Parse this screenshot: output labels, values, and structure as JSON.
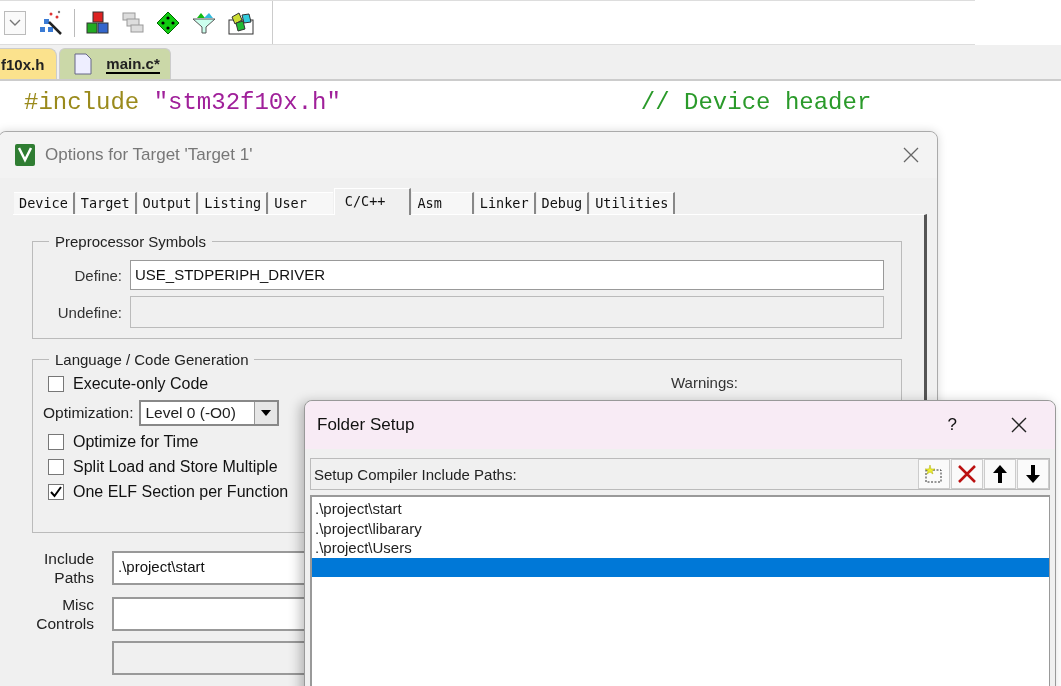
{
  "editor": {
    "tabs": [
      {
        "label": "f10x.h",
        "selected": false
      },
      {
        "label": "main.c*",
        "selected": true
      }
    ],
    "code_line": {
      "directive": "#include",
      "header": "\"stm32f10x.h\"",
      "comment": "// Device header"
    }
  },
  "options_dialog": {
    "title": "Options for Target 'Target 1'",
    "tabs": [
      {
        "label": "Device",
        "selected": false
      },
      {
        "label": "Target",
        "selected": false
      },
      {
        "label": "Output",
        "selected": false
      },
      {
        "label": "Listing",
        "selected": false
      },
      {
        "label": "User",
        "selected": false
      },
      {
        "label": "C/C++",
        "selected": true
      },
      {
        "label": "Asm",
        "selected": false
      },
      {
        "label": "Linker",
        "selected": false
      },
      {
        "label": "Debug",
        "selected": false
      },
      {
        "label": "Utilities",
        "selected": false
      }
    ],
    "preprocessor": {
      "title": "Preprocessor Symbols",
      "define_label": "Define:",
      "define_value": "USE_STDPERIPH_DRIVER",
      "undefine_label": "Undefine:",
      "undefine_disabled": true
    },
    "code_generation": {
      "title": "Language / Code Generation",
      "execute_only": {
        "label": "Execute-only Code",
        "checked": false
      },
      "optimization_label": "Optimization:",
      "optimization_value": "Level 0 (-O0)",
      "options": [
        {
          "label": "Optimize for Time",
          "checked": false
        },
        {
          "label": "Split Load and Store Multiple",
          "checked": false
        },
        {
          "label": "One ELF Section per Function",
          "checked": true
        }
      ],
      "warnings_label": "Warnings:"
    },
    "include_paths": {
      "label": "Include Paths",
      "value": ".\\project\\start"
    },
    "misc_controls": {
      "label": "Misc Controls"
    }
  },
  "folder_setup": {
    "title": "Folder Setup",
    "help": "?",
    "list_title": "Setup Compiler Include Paths:",
    "paths": [
      {
        "text": ".\\project\\start",
        "selected": false
      },
      {
        "text": ".\\project\\libarary",
        "selected": false
      },
      {
        "text": ".\\project\\Users",
        "selected": false
      },
      {
        "selected": true
      }
    ]
  }
}
